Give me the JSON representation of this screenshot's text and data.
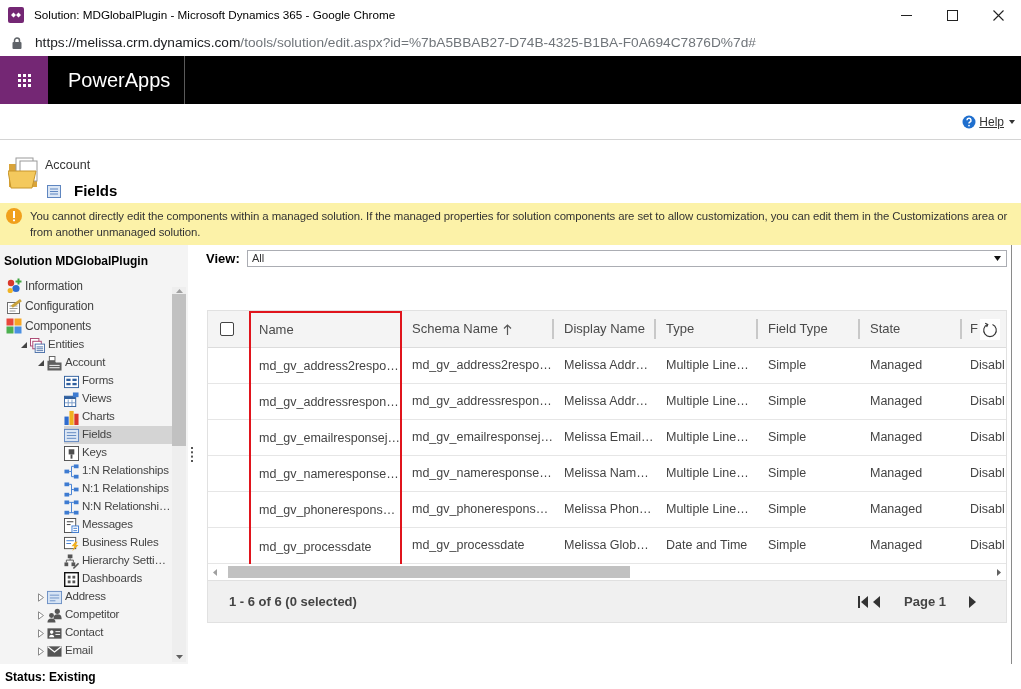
{
  "window": {
    "title": "Solution: MDGlobalPlugin - Microsoft Dynamics 365 - Google Chrome"
  },
  "address_bar": {
    "host": "https://melissa.crm.dynamics.com",
    "path": "/tools/solution/edit.aspx?id=%7bA5BBAB27-D74B-4325-B1BA-F0A694C7876D%7d#"
  },
  "app_bar": {
    "title": "PowerApps"
  },
  "help": {
    "label": "Help"
  },
  "page_header": {
    "breadcrumb": "Account",
    "title": "Fields"
  },
  "notice": {
    "kind": "warning",
    "text": "You cannot directly edit the components within a managed solution. If the managed properties for solution components are set to allow customization, you can edit them in the Customizations area or from another unmanaged solution."
  },
  "sidebar": {
    "title": "Solution MDGlobalPlugin",
    "items": [
      {
        "label": "Information",
        "kind": "information",
        "selected": false
      },
      {
        "label": "Configuration",
        "kind": "configuration",
        "selected": false
      },
      {
        "label": "Components",
        "kind": "components",
        "selected": false,
        "children": [
          {
            "label": "Entities",
            "kind": "entities",
            "selected": false,
            "expanded": true,
            "children": [
              {
                "label": "Account",
                "kind": "entity",
                "selected": false,
                "expanded": true,
                "children": [
                  {
                    "label": "Forms",
                    "kind": "forms",
                    "selected": false
                  },
                  {
                    "label": "Views",
                    "kind": "views",
                    "selected": false
                  },
                  {
                    "label": "Charts",
                    "kind": "charts",
                    "selected": false
                  },
                  {
                    "label": "Fields",
                    "kind": "fields",
                    "selected": true
                  },
                  {
                    "label": "Keys",
                    "kind": "keys",
                    "selected": false
                  },
                  {
                    "label": "1:N Relationships",
                    "kind": "onetomany",
                    "selected": false
                  },
                  {
                    "label": "N:1 Relationships",
                    "kind": "manytoone",
                    "selected": false
                  },
                  {
                    "label": "N:N Relationshi…",
                    "kind": "manytomany",
                    "selected": false
                  },
                  {
                    "label": "Messages",
                    "kind": "messages",
                    "selected": false
                  },
                  {
                    "label": "Business Rules",
                    "kind": "rules",
                    "selected": false
                  },
                  {
                    "label": "Hierarchy Setti…",
                    "kind": "hierarchy",
                    "selected": false
                  },
                  {
                    "label": "Dashboards",
                    "kind": "dashboards",
                    "selected": false
                  }
                ]
              },
              {
                "label": "Address",
                "kind": "address",
                "selected": false,
                "expanded": false
              },
              {
                "label": "Competitor",
                "kind": "competitor",
                "selected": false,
                "expanded": false
              },
              {
                "label": "Contact",
                "kind": "contact",
                "selected": false,
                "expanded": false
              },
              {
                "label": "Email",
                "kind": "email",
                "selected": false,
                "expanded": false
              }
            ]
          }
        ]
      }
    ]
  },
  "view_selector": {
    "label": "View:",
    "value": "All"
  },
  "table": {
    "select_all": {
      "checked": false
    },
    "columns": [
      {
        "label": "Name",
        "sorted": false,
        "highlighted": true
      },
      {
        "label": "Schema Name",
        "sorted": true,
        "highlighted": false
      },
      {
        "label": "Display Name",
        "sorted": false,
        "highlighted": false
      },
      {
        "label": "Type",
        "sorted": false,
        "highlighted": false
      },
      {
        "label": "Field Type",
        "sorted": false,
        "highlighted": false
      },
      {
        "label": "State",
        "sorted": false,
        "highlighted": false
      },
      {
        "label": "F",
        "sorted": false,
        "highlighted": false
      }
    ],
    "rows": [
      {
        "selected": false,
        "cells": [
          "md_gv_address2respo…",
          "md_gv_address2respo…",
          "Melissa Addr…",
          "Multiple Line…",
          "Simple",
          "Managed",
          "Disabl"
        ]
      },
      {
        "selected": false,
        "cells": [
          "md_gv_addressrespon…",
          "md_gv_addressrespon…",
          "Melissa Addr…",
          "Multiple Line…",
          "Simple",
          "Managed",
          "Disabl"
        ]
      },
      {
        "selected": false,
        "cells": [
          "md_gv_emailresponsej…",
          "md_gv_emailresponsej…",
          "Melissa Email…",
          "Multiple Line…",
          "Simple",
          "Managed",
          "Disabl"
        ]
      },
      {
        "selected": false,
        "cells": [
          "md_gv_nameresponse…",
          "md_gv_nameresponse…",
          "Melissa Nam…",
          "Multiple Line…",
          "Simple",
          "Managed",
          "Disabl"
        ]
      },
      {
        "selected": false,
        "cells": [
          "md_gv_phonerespons…",
          "md_gv_phonerespons…",
          "Melissa Phon…",
          "Multiple Line…",
          "Simple",
          "Managed",
          "Disabl"
        ]
      },
      {
        "selected": false,
        "cells": [
          "md_gv_processdate",
          "md_gv_processdate",
          "Melissa Glob…",
          "Date and Time",
          "Simple",
          "Managed",
          "Disabl"
        ]
      }
    ]
  },
  "footer": {
    "summary": "1 - 6 of 6 (0 selected)",
    "page": "Page 1"
  },
  "status_bar": {
    "text": "Status: Existing"
  }
}
